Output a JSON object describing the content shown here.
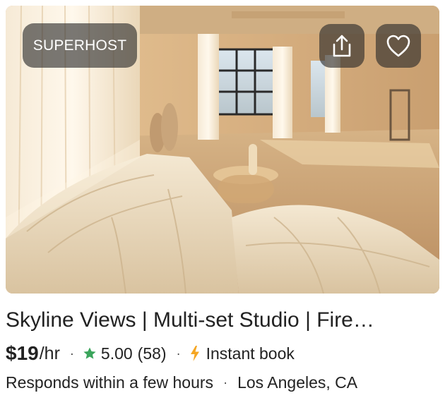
{
  "listing": {
    "badge": "SUPERHOST",
    "title": "Skyline Views | Multi-set Studio | Fire…",
    "price": "$19",
    "price_unit": "/hr",
    "separator": "·",
    "rating": "5.00",
    "review_count": "(58)",
    "booking_type": "Instant book",
    "response_time": "Responds within a few hours",
    "location": "Los Angeles, CA"
  },
  "icons": {
    "share": "share-icon",
    "favorite": "heart-icon",
    "rating": "star-icon",
    "instant": "lightning-bolt-icon"
  },
  "colors": {
    "star": "#3ba55c",
    "bolt": "#f5a623",
    "overlay": "#282828"
  }
}
